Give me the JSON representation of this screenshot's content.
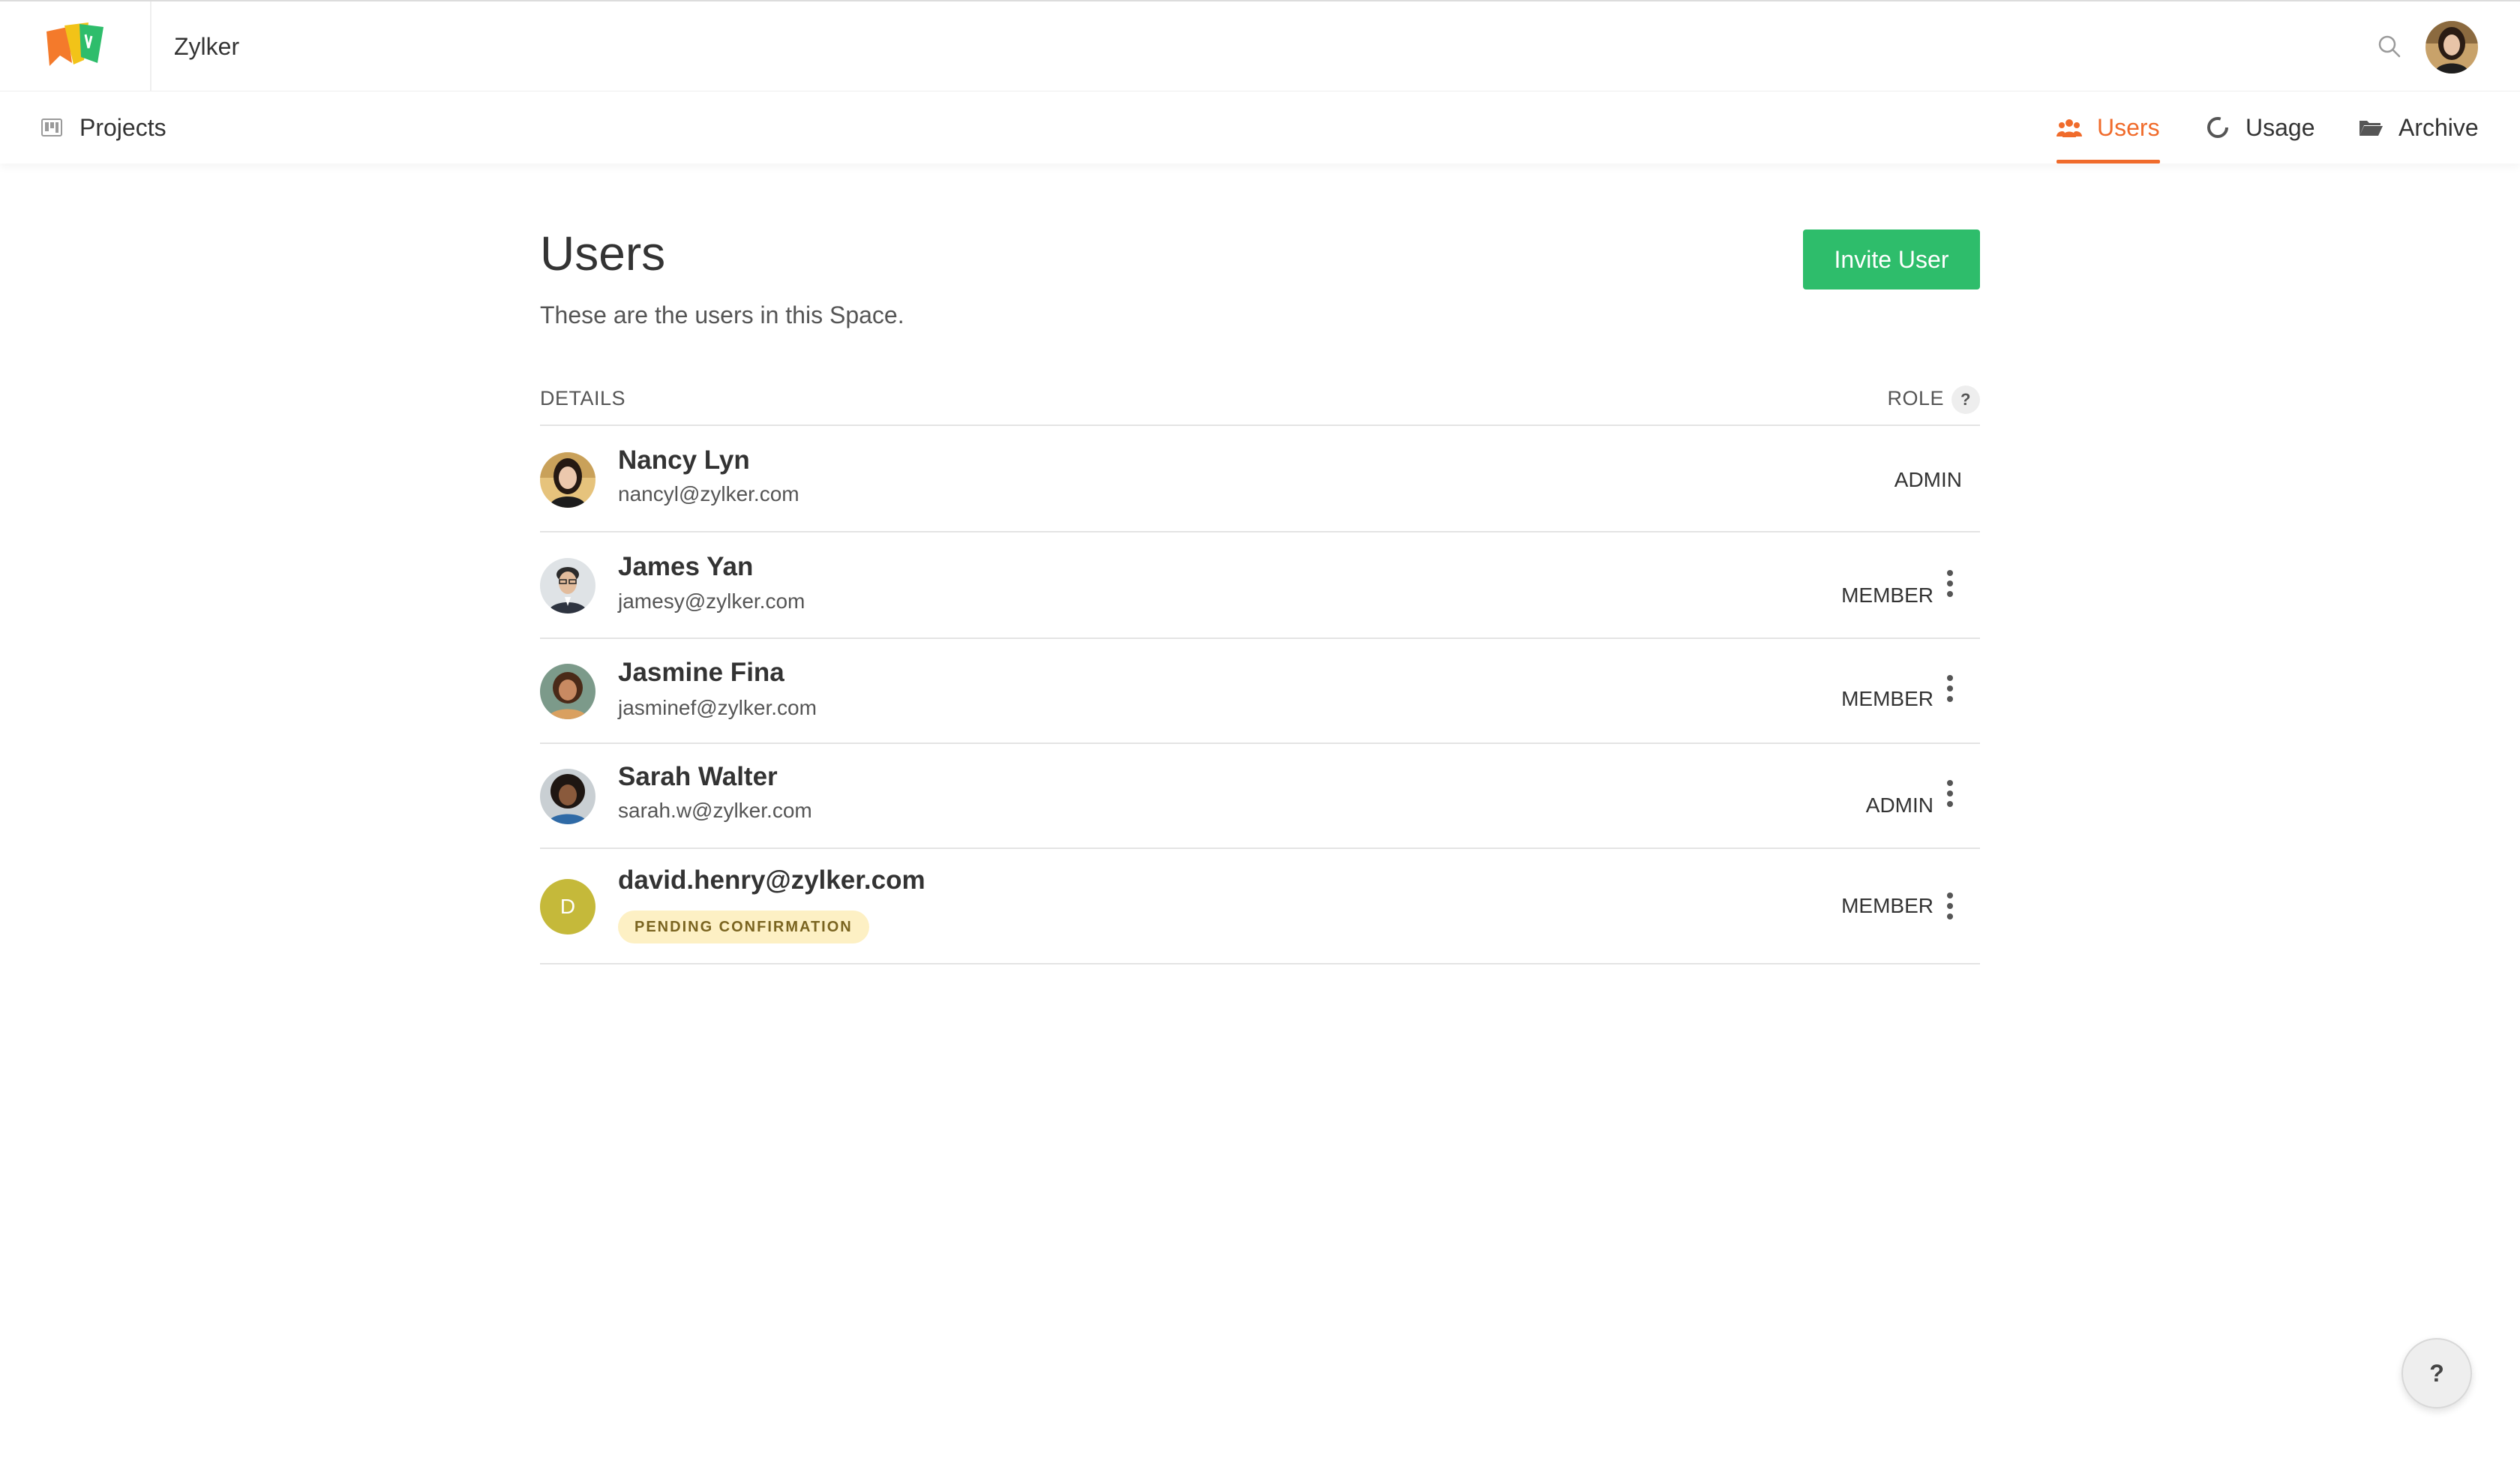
{
  "header": {
    "org_name": "Zylker",
    "logo_icon": "zylker-folder-logo-icon",
    "search_icon": "search-icon",
    "brand_colors": {
      "orange": "#f06b2b",
      "green": "#2ebd6b"
    }
  },
  "nav": {
    "left": [
      {
        "label": "Projects",
        "icon": "projects-board-icon"
      }
    ],
    "right": [
      {
        "label": "Users",
        "icon": "users-group-icon",
        "active": true
      },
      {
        "label": "Usage",
        "icon": "usage-donut-icon",
        "active": false
      },
      {
        "label": "Archive",
        "icon": "archive-folder-icon",
        "active": false
      }
    ]
  },
  "page": {
    "title": "Users",
    "subtitle": "These are the users in this Space.",
    "invite_label": "Invite User"
  },
  "table": {
    "col_details": "DETAILS",
    "col_role": "ROLE",
    "role_help": "?"
  },
  "users": [
    {
      "name": "Nancy Lyn",
      "email": "nancyl@zylker.com",
      "role": "ADMIN",
      "has_menu": false
    },
    {
      "name": "James Yan",
      "email": "jamesy@zylker.com",
      "role": "MEMBER",
      "has_menu": true
    },
    {
      "name": "Jasmine Fina",
      "email": "jasminef@zylker.com",
      "role": "MEMBER",
      "has_menu": true
    },
    {
      "name": "Sarah Walter",
      "email": "sarah.w@zylker.com",
      "role": "ADMIN",
      "has_menu": true
    },
    {
      "name": "david.henry@zylker.com",
      "badge": "PENDING CONFIRMATION",
      "initial": "D",
      "role": "MEMBER",
      "has_menu": true
    }
  ],
  "help_fab": "?"
}
